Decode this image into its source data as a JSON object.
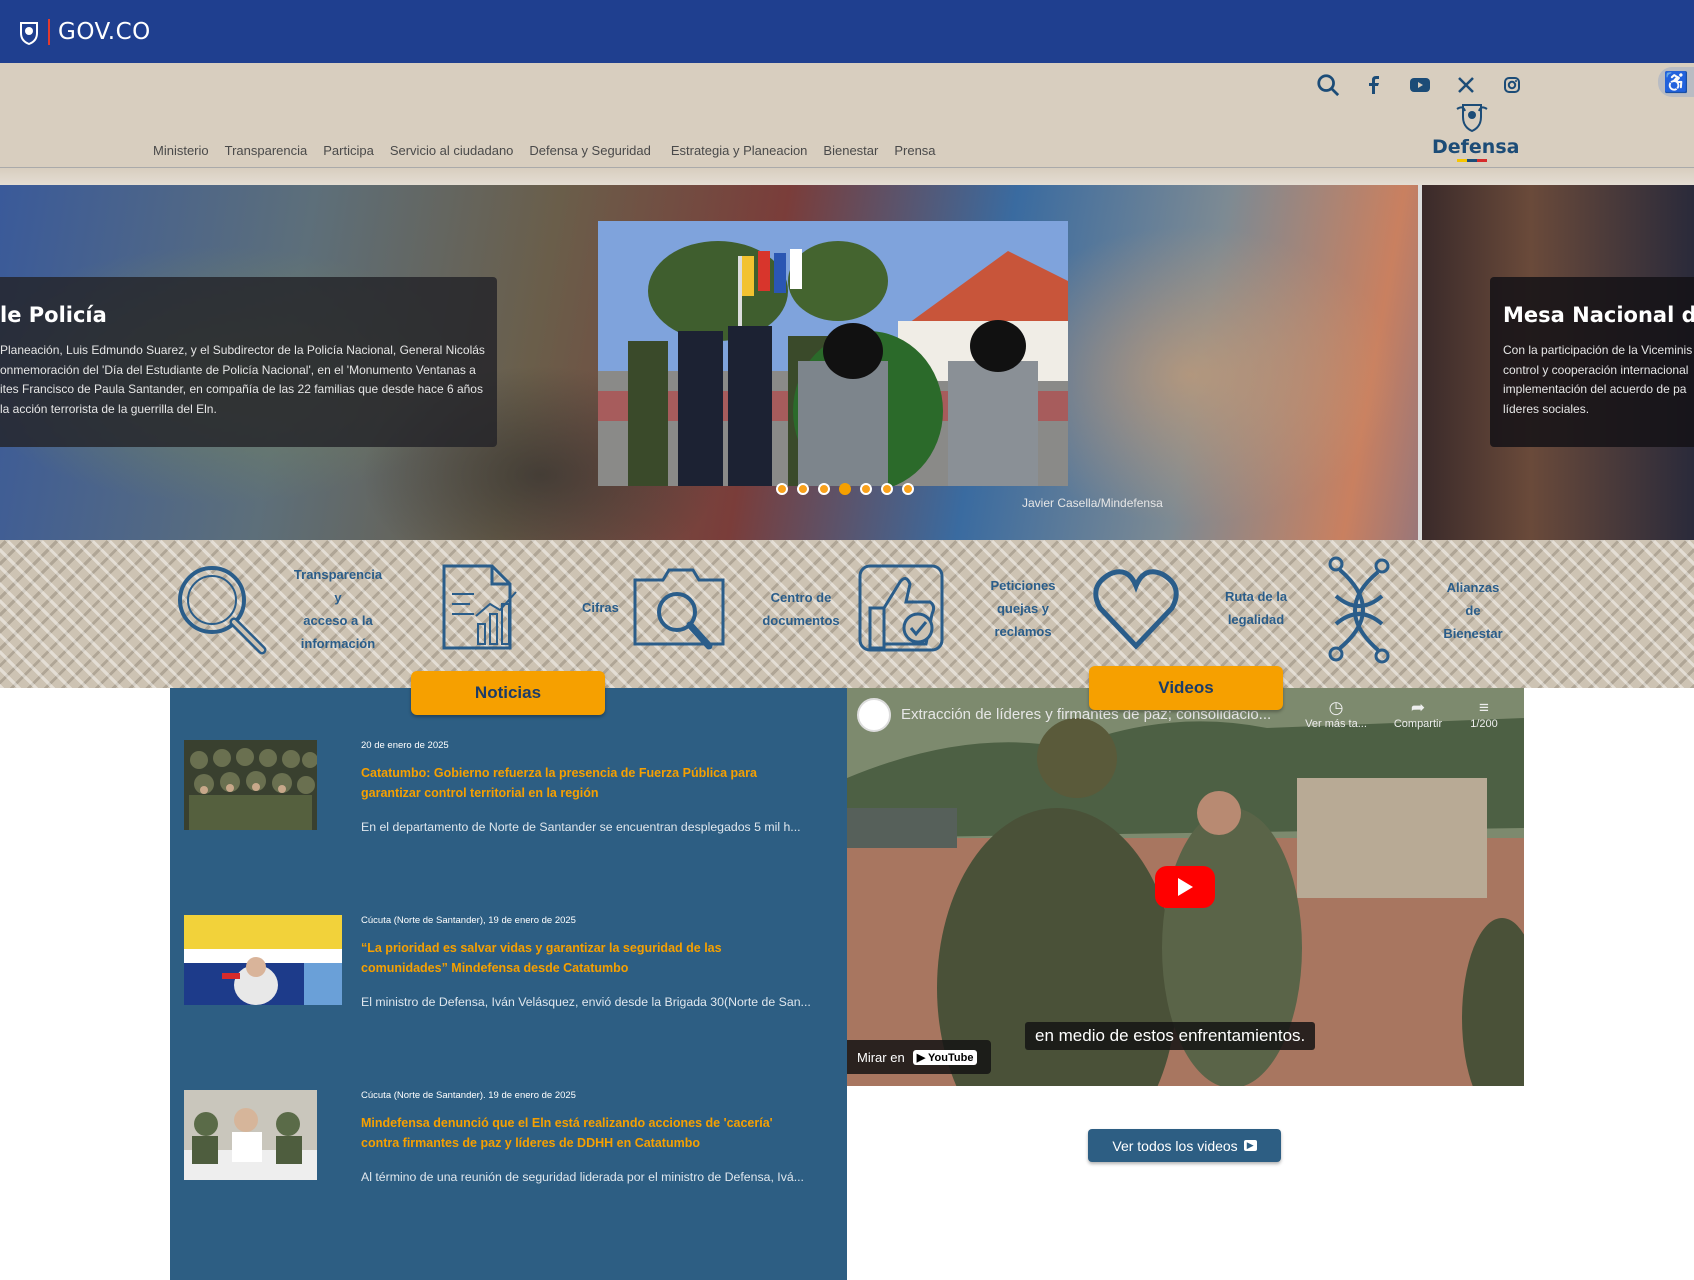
{
  "gov": {
    "label": "GOV.CO"
  },
  "header": {
    "logo_text": "Defensa",
    "social": [
      "search-icon",
      "facebook-icon",
      "youtube-icon",
      "x-icon",
      "instagram-icon"
    ],
    "nav": [
      "Ministerio",
      "Transparencia",
      "Participa",
      "Servicio al ciudadano",
      "Defensa y Seguridad",
      "Estrategia y Planeacion",
      "Bienestar",
      "Prensa"
    ]
  },
  "hero": {
    "left_title": "le Policía",
    "left_text": [
      "Planeación, Luis Edmundo Suarez, y el Subdirector de la Policía Nacional, General Nicolás",
      "onmemoración del 'Día del Estudiante de Policía Nacional', en el 'Monumento Ventanas a",
      "ites Francisco de Paula Santander, en compañía de las 22 familias que desde hace 6 años",
      "la acción terrorista de la guerrilla del Eln."
    ],
    "right_title": "Mesa Nacional de G",
    "right_text": [
      "Con la participación de la Viceminis",
      "control y cooperación internacional",
      "implementación del acuerdo de pa",
      "líderes sociales."
    ],
    "caption": "Javier Casella/Mindefensa",
    "slides": 7,
    "active_slide": 4
  },
  "quick_access": [
    {
      "icon": "magnifier-icon",
      "label": "Transparencia y acceso a la información"
    },
    {
      "icon": "report-chart-icon",
      "label": "Cifras"
    },
    {
      "icon": "folder-search-icon",
      "label": "Centro de documentos"
    },
    {
      "icon": "thumbs-up-icon",
      "label": "Peticiones quejas y reclamos"
    },
    {
      "icon": "heart-icon",
      "label": "Ruta de la legalidad"
    },
    {
      "icon": "knot-icon",
      "label": "Alianzas de Bienestar"
    }
  ],
  "news": {
    "tab_label": "Noticias",
    "items": [
      {
        "date": "20 de enero de 2025",
        "title": "Catatumbo: Gobierno refuerza la presencia de Fuerza Pública para garantizar control territorial en la región",
        "excerpt": "En el departamento de Norte de Santander  se encuentran desplegados 5 mil h..."
      },
      {
        "date": "Cúcuta (Norte de Santander), 19 de enero de 2025",
        "title": "“La prioridad es salvar vidas y garantizar la seguridad de las comunidades” Mindefensa desde Catatumbo",
        "excerpt": "El ministro de Defensa, Iván Velásquez, envió desde la Brigada 30(Norte de San..."
      },
      {
        "date": "Cúcuta (Norte de Santander). 19 de enero de 2025",
        "title": "Mindefensa denunció que el Eln está realizando acciones de 'cacería' contra firmantes de paz y líderes de DDHH en Catatumbo",
        "excerpt": "Al término de una reunión de seguridad liderada por el ministro de Defensa, Ivá..."
      }
    ]
  },
  "videos": {
    "tab_label": "Videos",
    "video_title": "Extracción de líderes y firmantes de paz; consolidacio...",
    "watch_later": "Ver más ta...",
    "share": "Compartir",
    "playlist": "1/200",
    "subtitle": "en medio de estos enfrentamientos.",
    "watch_on": "Mirar en",
    "youtube": "YouTube",
    "all_button": "Ver todos los videos"
  },
  "colors": {
    "gov_blue": "#1f3f8f",
    "accent_orange": "#f6a000",
    "news_blue": "#2d5e83",
    "header_beige": "#d8cebf"
  }
}
